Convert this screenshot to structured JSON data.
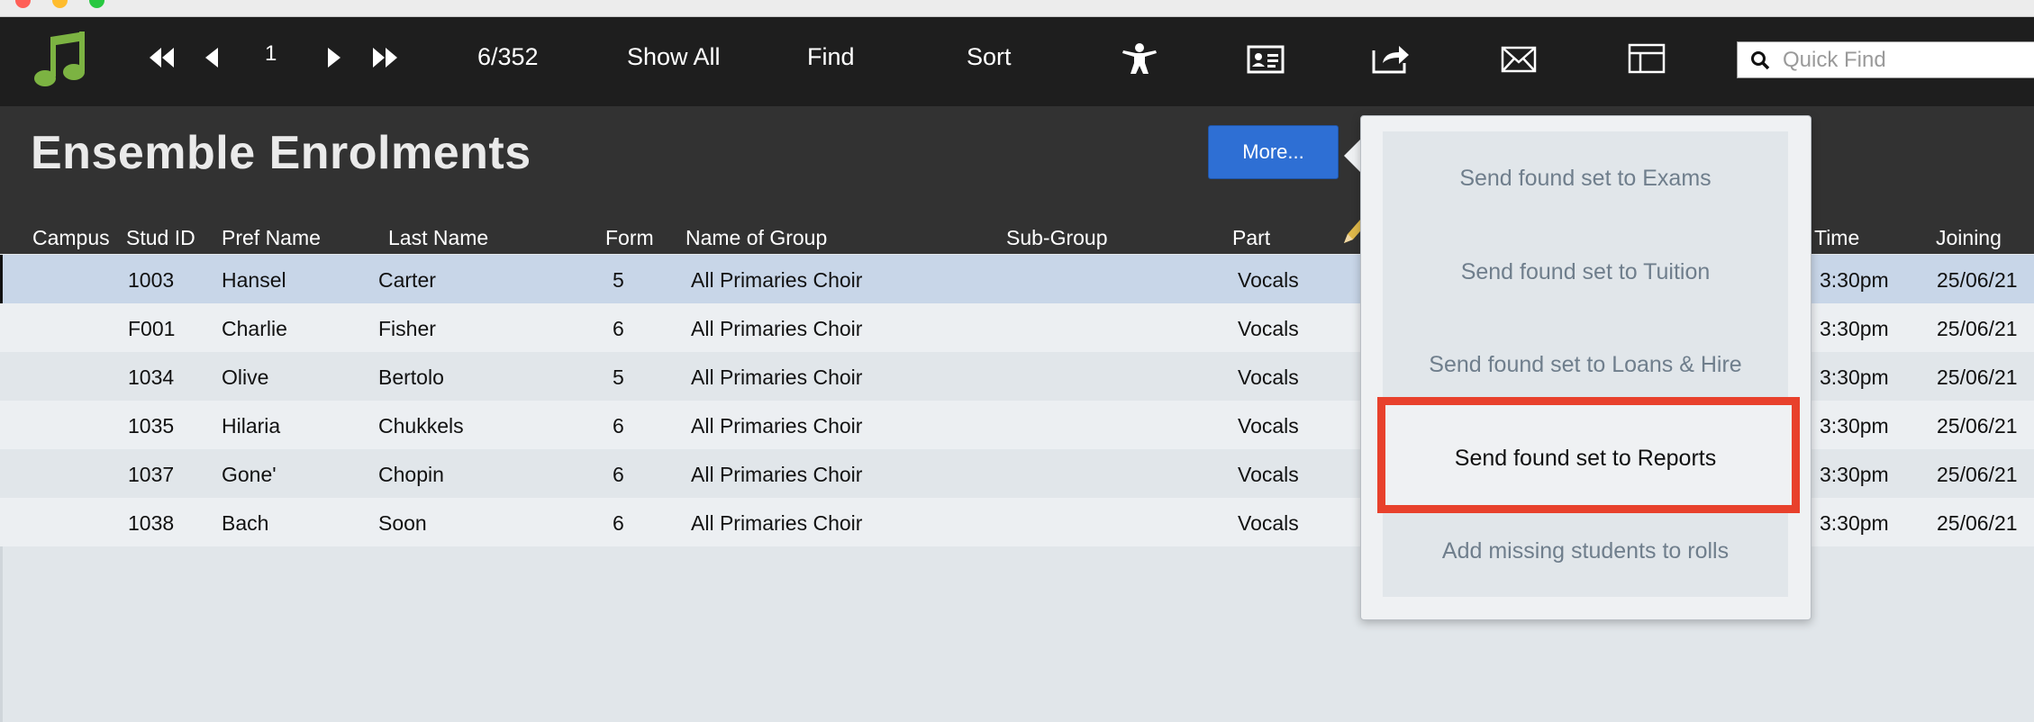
{
  "toolbar": {
    "record_number": "1",
    "record_count": "6/352",
    "show_all_label": "Show All",
    "find_label": "Find",
    "sort_label": "Sort",
    "quick_find_placeholder": "Quick Find",
    "icons": [
      "music-note-icon",
      "first-record-icon",
      "previous-record-icon",
      "next-record-icon",
      "last-record-icon",
      "person-icon",
      "contact-card-icon",
      "export-icon",
      "mail-icon",
      "layout-icon",
      "search-icon"
    ],
    "logo_color": "#7cb342"
  },
  "header": {
    "title": "Ensemble Enrolments",
    "more_button_label": "More..."
  },
  "table": {
    "columns": [
      "Campus",
      "Stud ID",
      "Pref Name",
      "Last Name",
      "Form",
      "Name of Group",
      "Sub-Group",
      "Part",
      "Time",
      "Joining"
    ],
    "rows": [
      {
        "stud_id": "1003",
        "pref_name": "Hansel",
        "last_name": "Carter",
        "form": "5",
        "group": "All Primaries Choir",
        "part": "Vocals",
        "time": "3:30pm",
        "joining": "25/06/21"
      },
      {
        "stud_id": "F001",
        "pref_name": "Charlie",
        "last_name": "Fisher",
        "form": "6",
        "group": "All Primaries Choir",
        "part": "Vocals",
        "time": "3:30pm",
        "joining": "25/06/21"
      },
      {
        "stud_id": "1034",
        "pref_name": "Olive",
        "last_name": "Bertolo",
        "form": "5",
        "group": "All Primaries Choir",
        "part": "Vocals",
        "time": "3:30pm",
        "joining": "25/06/21"
      },
      {
        "stud_id": "1035",
        "pref_name": "Hilaria",
        "last_name": "Chukkels",
        "form": "6",
        "group": "All Primaries Choir",
        "part": "Vocals",
        "time": "3:30pm",
        "joining": "25/06/21"
      },
      {
        "stud_id": "1037",
        "pref_name": "Gone'",
        "last_name": "Chopin",
        "form": "6",
        "group": "All Primaries Choir",
        "part": "Vocals",
        "time": "3:30pm",
        "joining": "25/06/21"
      },
      {
        "stud_id": "1038",
        "pref_name": "Bach",
        "last_name": "Soon",
        "form": "6",
        "group": "All Primaries Choir",
        "part": "Vocals",
        "time": "3:30pm",
        "joining": "25/06/21"
      }
    ]
  },
  "popover": {
    "items": [
      "Send found set to Exams",
      "Send found set to Tuition",
      "Send found set to Loans & Hire",
      "Send found set to Reports",
      "Add missing students to rolls"
    ],
    "highlighted_item": "Send found set to Reports",
    "highlight_color": "#e8412c"
  },
  "colors": {
    "toolbar_bg": "#1e1e1e",
    "header_bg": "#323232",
    "selected_row": "#c8d6e8",
    "row_light": "#eceff2",
    "row_dark": "#e1e6ea",
    "accent_button": "#2e6fd4"
  }
}
